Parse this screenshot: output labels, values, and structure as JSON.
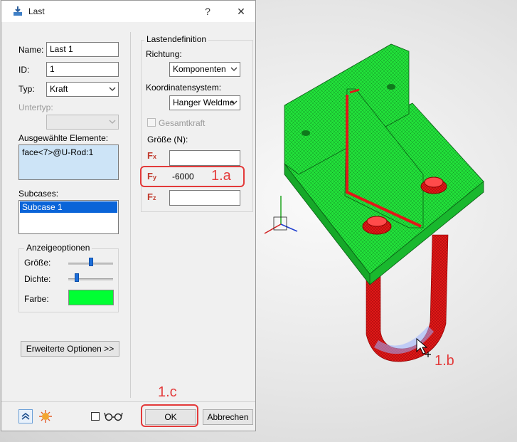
{
  "window": {
    "title": "Last",
    "help": "?",
    "close": "✕"
  },
  "form": {
    "name_label": "Name:",
    "name_value": "Last 1",
    "id_label": "ID:",
    "id_value": "1",
    "typ_label": "Typ:",
    "typ_value": "Kraft",
    "untertyp_label": "Untertyp:",
    "elements_label": "Ausgewählte Elemente:",
    "elements_value": "face<7>@U-Rod:1",
    "subcases_label": "Subcases:",
    "subcase_item": "Subcase 1"
  },
  "display_options": {
    "title": "Anzeigeoptionen",
    "groesse_label": "Größe:",
    "groesse_level": 0.5,
    "dichte_label": "Dichte:",
    "dichte_level": 0.15,
    "farbe_label": "Farbe:",
    "farbe_color": "#00ff33"
  },
  "advanced_button": "Erweiterte Optionen >>",
  "load_definition": {
    "title": "Lastendefinition",
    "richtung_label": "Richtung:",
    "richtung_value": "Komponenten",
    "koordsys_label": "Koordinatensystem:",
    "koordsys_value": "Hanger Weldme",
    "gesamtkraft_label": "Gesamtkraft",
    "groesse_label": "Größe (N):",
    "fx": {
      "main": "F",
      "sub": "x",
      "value": ""
    },
    "fy": {
      "main": "F",
      "sub": "y",
      "value": "-6000"
    },
    "fz": {
      "main": "F",
      "sub": "z",
      "value": ""
    }
  },
  "footer": {
    "ok": "OK",
    "cancel": "Abbrechen"
  },
  "annotations": {
    "a": "1.a",
    "b": "1.b",
    "c": "1.c"
  },
  "colors": {
    "accent_red": "#e33a3a",
    "mesh_green": "#22e03a",
    "mesh_red": "#e01818",
    "selection_blue": "#0a64d8"
  }
}
